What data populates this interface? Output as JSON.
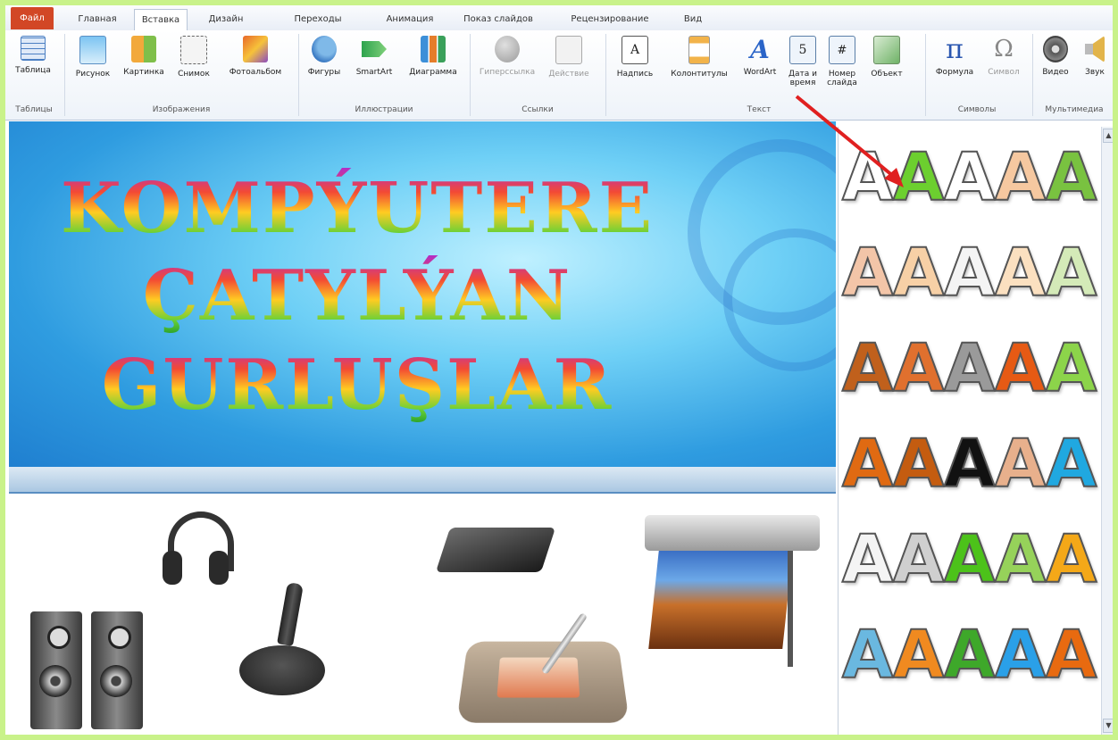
{
  "tabs": [
    "Файл",
    "Главная",
    "Вставка",
    "Дизайн",
    "Переходы",
    "Анимация",
    "Показ слайдов",
    "Рецензирование",
    "Вид"
  ],
  "ribbon": {
    "buttons": {
      "table": "Таблица",
      "picture": "Рисунок",
      "clipart": "Картинка",
      "screenshot": "Снимок",
      "album": "Фотоальбом",
      "shapes": "Фигуры",
      "smartart": "SmartArt",
      "chart": "Диаграмма",
      "hyperlink": "Гиперссылка",
      "action": "Действие",
      "textbox": "Надпись",
      "header": "Колонтитулы",
      "wordart": "WordArt",
      "datetime_1": "Дата и",
      "datetime_2": "время",
      "slidenum_1": "Номер",
      "slidenum_2": "слайда",
      "object": "Объект",
      "equation": "Формула",
      "symbol": "Символ",
      "video": "Видео",
      "audio": "Звук"
    },
    "groups": {
      "tables": "Таблицы",
      "images": "Изображения",
      "illustrations": "Иллюстрации",
      "links": "Ссылки",
      "text": "Текст",
      "symbols": "Символы",
      "media": "Мультимедиа"
    }
  },
  "slide": {
    "line1": "KOMPÝUTERE",
    "line2": "ÇATYLÝAN",
    "line3": "GURLUŞLAR"
  },
  "gallery": {
    "letter": "A",
    "styles": [
      [
        "#ffffff",
        "#6ccf2f",
        "#ffffff",
        "#f6c8a0",
        "#79c240"
      ],
      [
        "#f3c5a8",
        "#f7d0a6",
        "#f4f4f4",
        "#fbe0c0",
        "#d4eab8"
      ],
      [
        "#c0601c",
        "#e0702e",
        "#9a9a9a",
        "#e65a14",
        "#8cd44a"
      ],
      [
        "#e06a12",
        "#c45c10",
        "#111111",
        "#e8b08c",
        "#20a8e0"
      ],
      [
        "#f4f4f4",
        "#cfcfcf",
        "#4cc21a",
        "#96d25a",
        "#f4a818"
      ],
      [
        "#6ab8e0",
        "#f08a20",
        "#3ea82a",
        "#2aa0e8",
        "#e86a10"
      ]
    ]
  },
  "colors": {
    "file_tab": "#d24726",
    "arrow": "#e02020",
    "background_border": "#c9f28a"
  }
}
